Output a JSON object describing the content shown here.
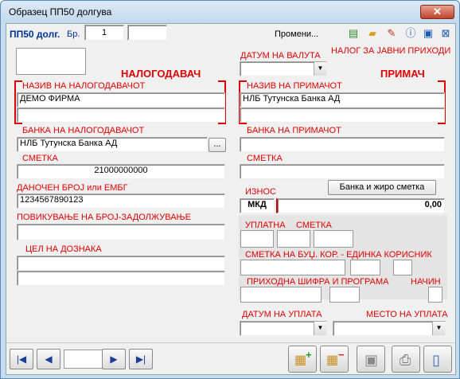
{
  "window": {
    "title": "Образец ПП50 долгува",
    "close": "✕"
  },
  "header": {
    "form_label": "ПП50 долг.",
    "br_label": "Бр.",
    "br_value": "1",
    "br_extra": "",
    "promeni": "Промени..."
  },
  "left": {
    "nalogodavac": "НАЛОГОДАВАЧ",
    "naziv_label": "НАЗИВ НА НАЛОГОДАВАЧОТ",
    "naziv_line1": "ДЕМО ФИРМА",
    "naziv_line2": "",
    "banka_label": "БАНКА НА НАЛОГОДАВАЧОТ",
    "banka_value": "НЛБ Тутунска Банка АД",
    "banka_btn": "...",
    "smetka_label": "СМЕТКА",
    "smetka_value": "21000000000",
    "danocen_label": "ДАНОЧЕН БРОЈ или ЕМБГ",
    "danocen_value": "1234567890123",
    "povikuvanje_label": "ПОВИКУВАЊЕ НА БРОЈ-ЗАДОЛЖУВАЊЕ",
    "povikuvanje_value": "",
    "cel_label": "ЦЕЛ НА ДОЗНАКА",
    "cel_line1": "",
    "cel_line2": ""
  },
  "right": {
    "datum_valuta_label": "ДАТУМ НА ВАЛУТА",
    "nalog_label": "НАЛОГ ЗА ЈАВНИ ПРИХОДИ",
    "primac": "ПРИМАЧ",
    "naziv_label": "НАЗИВ НА ПРИМАЧОТ",
    "naziv_line1": "НЛБ Тутунска Банка АД",
    "naziv_line2": "",
    "banka_label": "БАНКА НА ПРИМАЧОТ",
    "banka_value": "",
    "smetka_label": "СМЕТКА",
    "smetka_value": "",
    "iznos_label": "ИЗНОС",
    "banka_ziro_btn": "Банка и жиро сметка",
    "valuta": "МКД",
    "iznos_value": "0,00",
    "uplatna_label": "УПЛАТНА",
    "smetka2_label": "СМЕТКА",
    "smetka_buc_label": "СМЕТКА НА БУЏ. КОР. - ЕДИНКА КОРИСНИК",
    "prihodna_label": "ПРИХОДНА ШИФРА И ПРОГРАМА",
    "nacin_label": "НАЧИН",
    "datum_uplata_label": "ДАТУМ НА УПЛАТА",
    "mesto_uplata_label": "МЕСТО НА УПЛАТА"
  },
  "nav": {
    "first": "|◀",
    "prev": "◀",
    "next": "▶",
    "last": "▶|",
    "record": ""
  },
  "icons": [
    "document-icon",
    "folder-icon",
    "pen-icon",
    "help-icon",
    "window-icon",
    "close-icon",
    "add-document-icon",
    "remove-document-icon",
    "save-icon",
    "print-icon",
    "page-icon"
  ]
}
